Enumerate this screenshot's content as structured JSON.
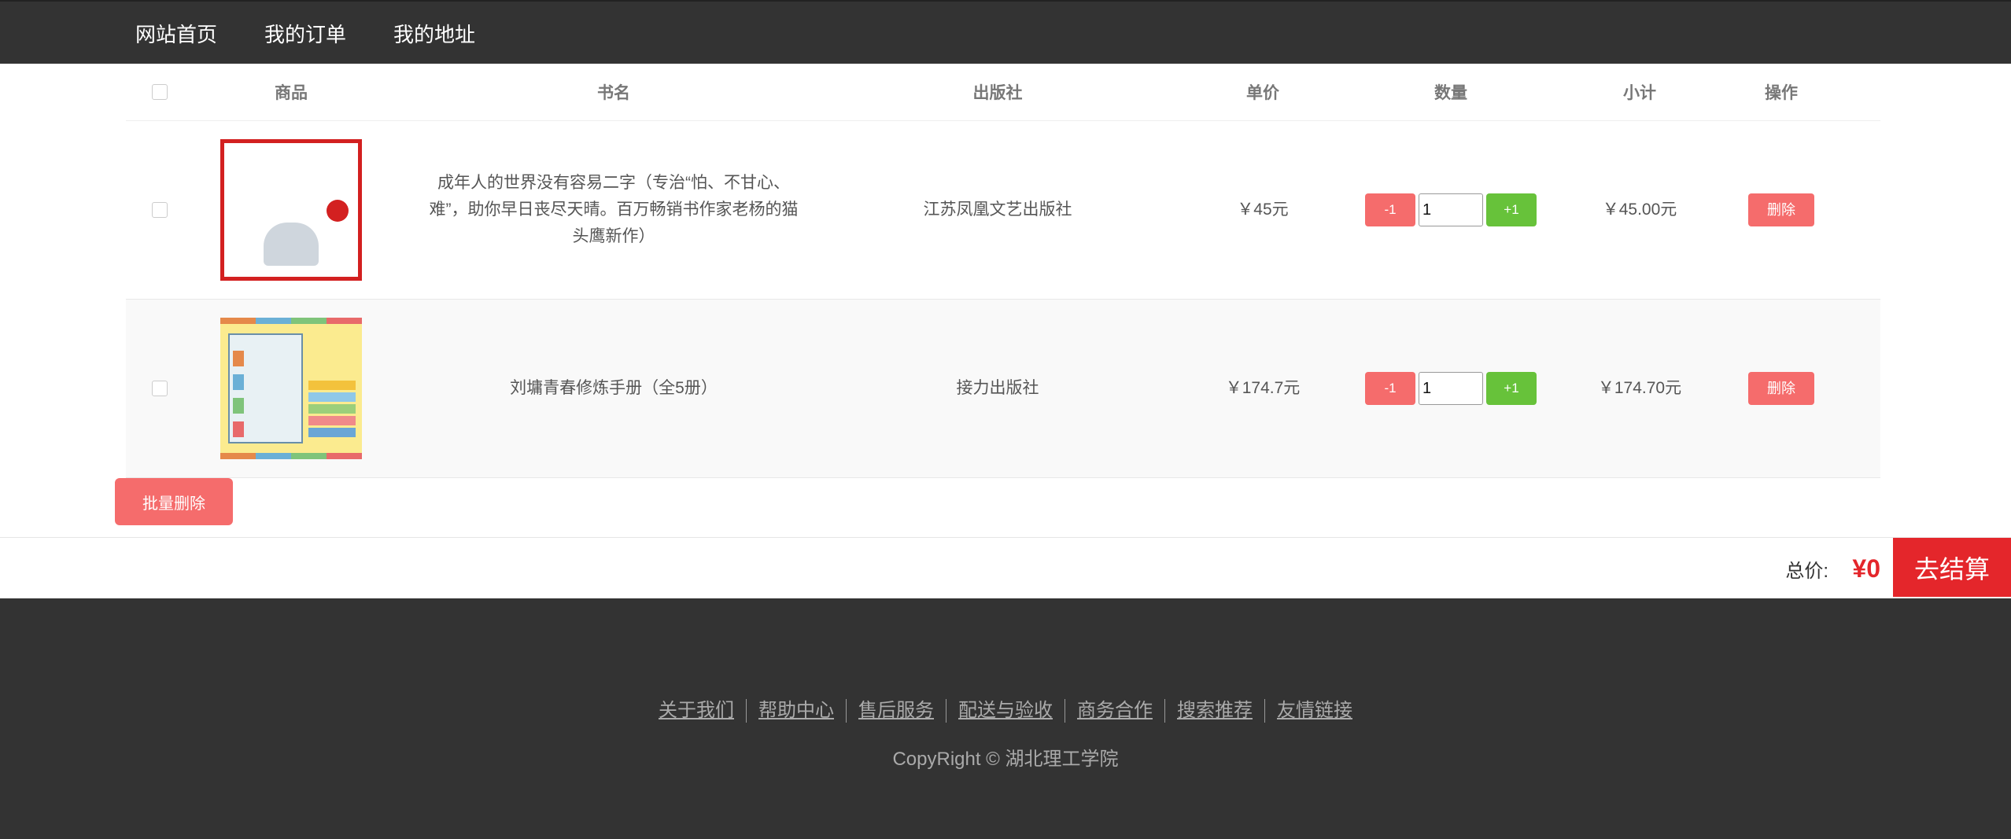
{
  "nav": {
    "items": [
      {
        "label": "网站首页"
      },
      {
        "label": "我的订单"
      },
      {
        "label": "我的地址"
      }
    ]
  },
  "table": {
    "headers": {
      "product": "商品",
      "name": "书名",
      "publisher": "出版社",
      "price": "单价",
      "quantity": "数量",
      "subtotal": "小计",
      "action": "操作"
    },
    "rows": [
      {
        "name": "成年人的世界没有容易二字（专治“怕、不甘心、难”，助你早日丧尽天晴。百万畅销书作家老杨的猫头鹰新作）",
        "publisher": "江苏凤凰文艺出版社",
        "price": "￥45元",
        "quantity": "1",
        "subtotal": "￥45.00元",
        "minus_label": "-1",
        "plus_label": "+1",
        "delete_label": "删除"
      },
      {
        "name": "刘墉青春修炼手册（全5册）",
        "publisher": "接力出版社",
        "price": "￥174.7元",
        "quantity": "1",
        "subtotal": "￥174.70元",
        "minus_label": "-1",
        "plus_label": "+1",
        "delete_label": "删除"
      }
    ]
  },
  "batch_delete_label": "批量删除",
  "summary": {
    "total_label": "总价:",
    "total_value": "¥0",
    "checkout_label": "去结算"
  },
  "footer": {
    "links": [
      {
        "label": "关于我们"
      },
      {
        "label": "帮助中心"
      },
      {
        "label": "售后服务"
      },
      {
        "label": "配送与验收"
      },
      {
        "label": "商务合作"
      },
      {
        "label": "搜索推荐"
      },
      {
        "label": "友情链接"
      }
    ],
    "copyright": "CopyRight © 湖北理工学院"
  },
  "colors": {
    "nav_bg": "#333333",
    "danger": "#f56c6c",
    "success": "#67c23a",
    "checkout": "#e4262b"
  }
}
